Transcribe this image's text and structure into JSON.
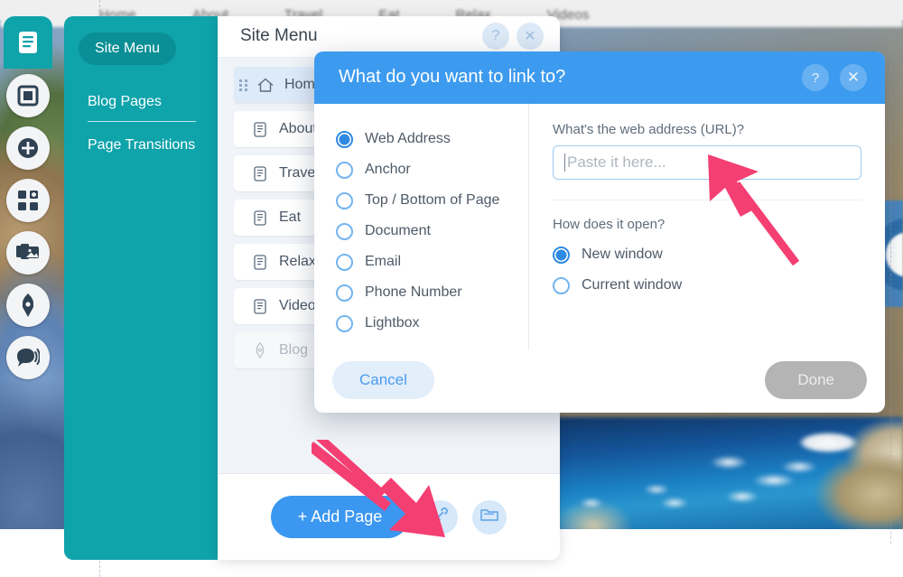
{
  "background": {
    "topnav_items": [
      "Home",
      "About",
      "Travel",
      "Eat",
      "Relax",
      "Videos"
    ]
  },
  "rail": {
    "items": [
      {
        "name": "pages-icon",
        "label": "Pages"
      },
      {
        "name": "frame-icon",
        "label": "Frame"
      },
      {
        "name": "plus-icon",
        "label": "Add"
      },
      {
        "name": "widgets-icon",
        "label": "Widgets"
      },
      {
        "name": "images-icon",
        "label": "Images"
      },
      {
        "name": "pen-icon",
        "label": "Design"
      },
      {
        "name": "speech-icon",
        "label": "Feedback"
      }
    ]
  },
  "teal_sidebar": {
    "active_item": "Site Menu",
    "items": [
      "Site Menu",
      "Blog Pages",
      "Page Transitions"
    ]
  },
  "menu_panel": {
    "title": "Site Menu",
    "help_glyph": "?",
    "close_glyph": "✕",
    "pages": [
      {
        "label": "Home",
        "icon": "home-icon",
        "active": true,
        "muted": false
      },
      {
        "label": "About",
        "icon": "document-icon",
        "active": false,
        "muted": false
      },
      {
        "label": "Travel",
        "icon": "document-icon",
        "active": false,
        "muted": false
      },
      {
        "label": "Eat",
        "icon": "document-icon",
        "active": false,
        "muted": false
      },
      {
        "label": "Relax",
        "icon": "document-icon",
        "active": false,
        "muted": false
      },
      {
        "label": "Videos",
        "icon": "document-icon",
        "active": false,
        "muted": false
      },
      {
        "label": "Blog",
        "icon": "pen-icon",
        "active": false,
        "muted": true
      }
    ],
    "add_page_label": "+ Add Page",
    "link_tool_name": "link-icon",
    "folder_tool_name": "add-folder-icon"
  },
  "dialog": {
    "title": "What do you want to link to?",
    "help_glyph": "?",
    "close_glyph": "✕",
    "link_types": [
      {
        "label": "Web Address",
        "selected": true
      },
      {
        "label": "Anchor",
        "selected": false
      },
      {
        "label": "Top / Bottom of Page",
        "selected": false
      },
      {
        "label": "Document",
        "selected": false
      },
      {
        "label": "Email",
        "selected": false
      },
      {
        "label": "Phone Number",
        "selected": false
      },
      {
        "label": "Lightbox",
        "selected": false
      }
    ],
    "url_field": {
      "label": "What's the web address (URL)?",
      "value": "",
      "placeholder": "Paste it here..."
    },
    "open_label": "How does it open?",
    "open_options": [
      {
        "label": "New window",
        "selected": true
      },
      {
        "label": "Current window",
        "selected": false
      }
    ],
    "cancel_label": "Cancel",
    "done_label": "Done"
  },
  "annotations": {
    "arrow_color": "#f43f72",
    "arrows": [
      {
        "name": "arrow-to-url-input",
        "points_to": "url-input"
      },
      {
        "name": "arrow-to-link-tool",
        "points_to": "link-tool-button"
      }
    ]
  }
}
